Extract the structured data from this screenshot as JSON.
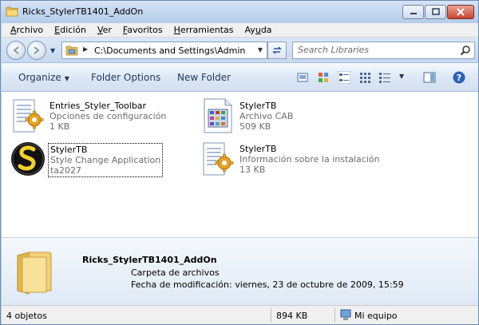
{
  "window": {
    "title": "Ricks_StylerTB1401_AddOn"
  },
  "menu": {
    "items": [
      {
        "u": "A",
        "rest": "rchivo"
      },
      {
        "u": "E",
        "rest": "dición"
      },
      {
        "u": "V",
        "rest": "er"
      },
      {
        "u": "F",
        "rest": "avoritos"
      },
      {
        "u": "H",
        "rest": "erramientas"
      },
      {
        "pre": "Ay",
        "u": "u",
        "rest": "da"
      }
    ]
  },
  "address": {
    "path": "C:\\Documents and Settings\\Admin"
  },
  "search": {
    "placeholder": "Search Libraries"
  },
  "toolbar": {
    "organize": "Organize",
    "folder_options": "Folder Options",
    "new_folder": "New Folder"
  },
  "files": [
    {
      "name": "Entries_Styler_Toolbar",
      "line2": "Opciones de configuración",
      "line3": "1 KB",
      "icon": "config-file-icon"
    },
    {
      "name": "StylerTB",
      "line2": "Archivo CAB",
      "line3": "509 KB",
      "icon": "cab-archive-icon"
    },
    {
      "name": "StylerTB",
      "line2": "Style Change Application",
      "line3": "ta2027",
      "icon": "styler-app-icon"
    },
    {
      "name": "StylerTB",
      "line2": "Información sobre la instalación",
      "line3": "13 KB",
      "icon": "setup-info-icon"
    }
  ],
  "details": {
    "name": "Ricks_StylerTB1401_AddOn",
    "type": "Carpeta de archivos",
    "date": "Fecha de modificación: viernes, 23 de octubre de 2009, 15:59"
  },
  "status": {
    "count": "4 objetos",
    "size": "894 KB",
    "location": "Mi equipo"
  }
}
